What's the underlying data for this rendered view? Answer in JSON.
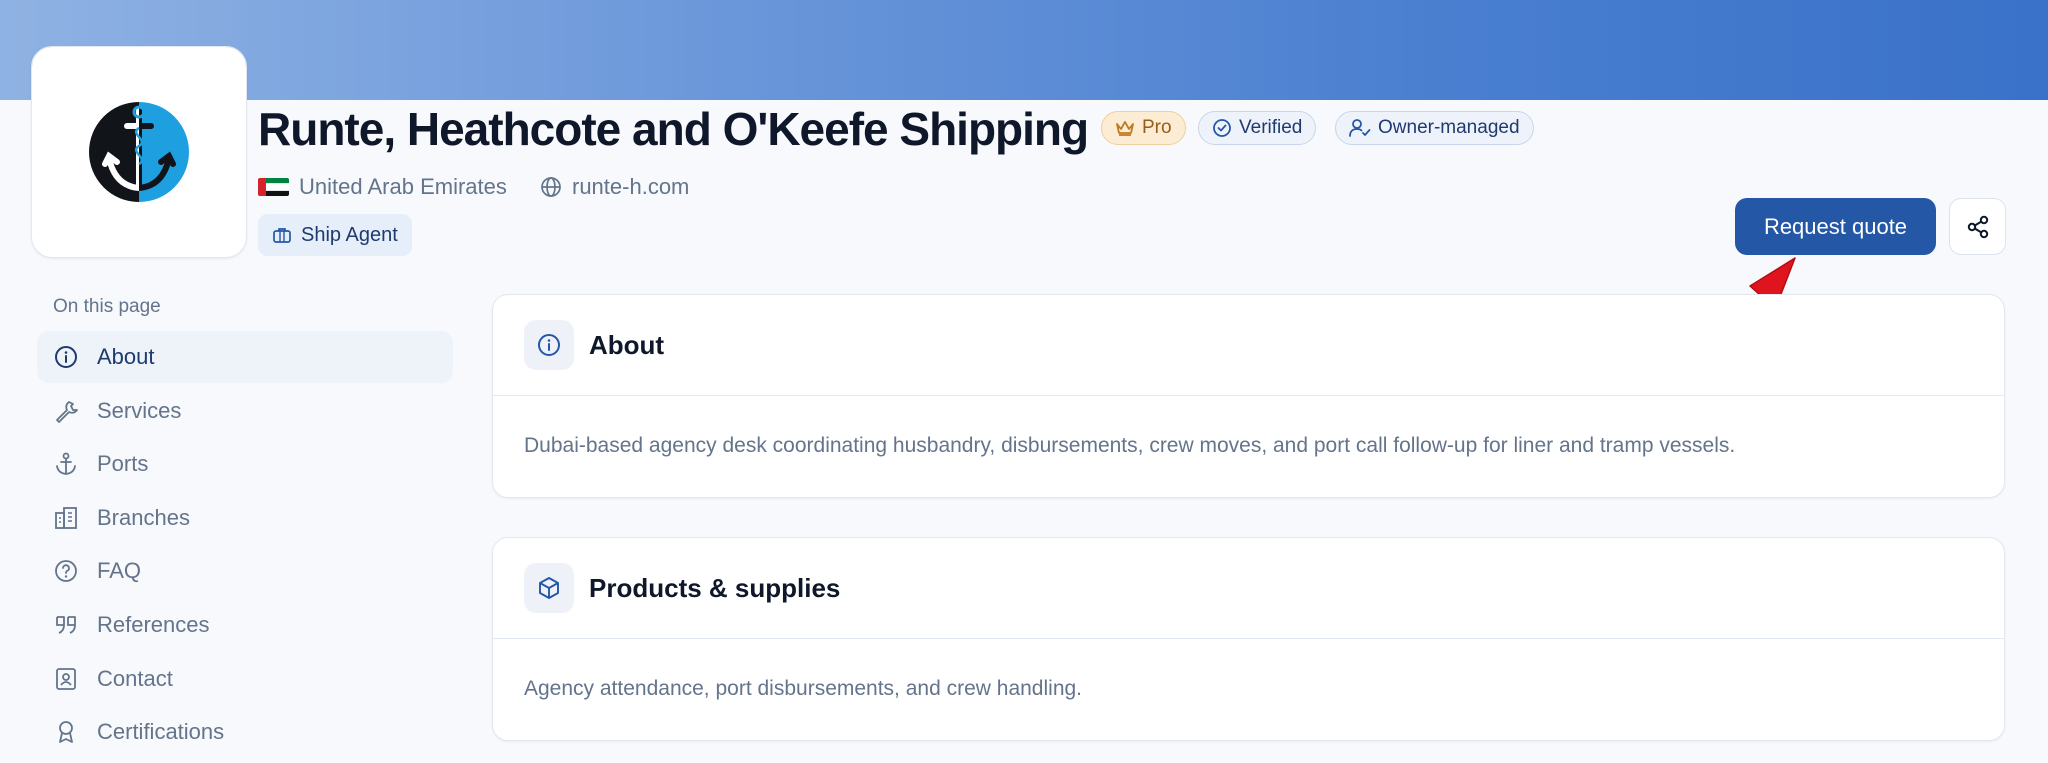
{
  "company": {
    "name": "Runte, Heathcote and O'Keefe Shipping",
    "country": "United Arab Emirates",
    "website": "runte-h.com",
    "category": "Ship Agent"
  },
  "badges": {
    "pro": "Pro",
    "verified": "Verified",
    "owner": "Owner-managed"
  },
  "actions": {
    "request_quote": "Request quote"
  },
  "toc": {
    "heading": "On this page",
    "items": [
      {
        "label": "About",
        "icon": "info-icon",
        "active": true
      },
      {
        "label": "Services",
        "icon": "wrench-icon"
      },
      {
        "label": "Ports",
        "icon": "anchor-icon"
      },
      {
        "label": "Branches",
        "icon": "building-icon"
      },
      {
        "label": "FAQ",
        "icon": "help-circle-icon"
      },
      {
        "label": "References",
        "icon": "quote-icon"
      },
      {
        "label": "Contact",
        "icon": "contact-card-icon"
      },
      {
        "label": "Certifications",
        "icon": "award-icon"
      }
    ]
  },
  "sections": {
    "about": {
      "title": "About",
      "text": "Dubai-based agency desk coordinating husbandry, disbursements, crew moves, and port call follow-up for liner and tramp vessels."
    },
    "products": {
      "title": "Products & supplies",
      "text": "Agency attendance, port disbursements, and crew handling."
    }
  },
  "colors": {
    "primary": "#2557a7",
    "banner_start": "#8fb2e3",
    "banner_end": "#3a72c9",
    "pro_badge_bg": "#fcecd4",
    "annotation_arrow": "#e0141e"
  }
}
